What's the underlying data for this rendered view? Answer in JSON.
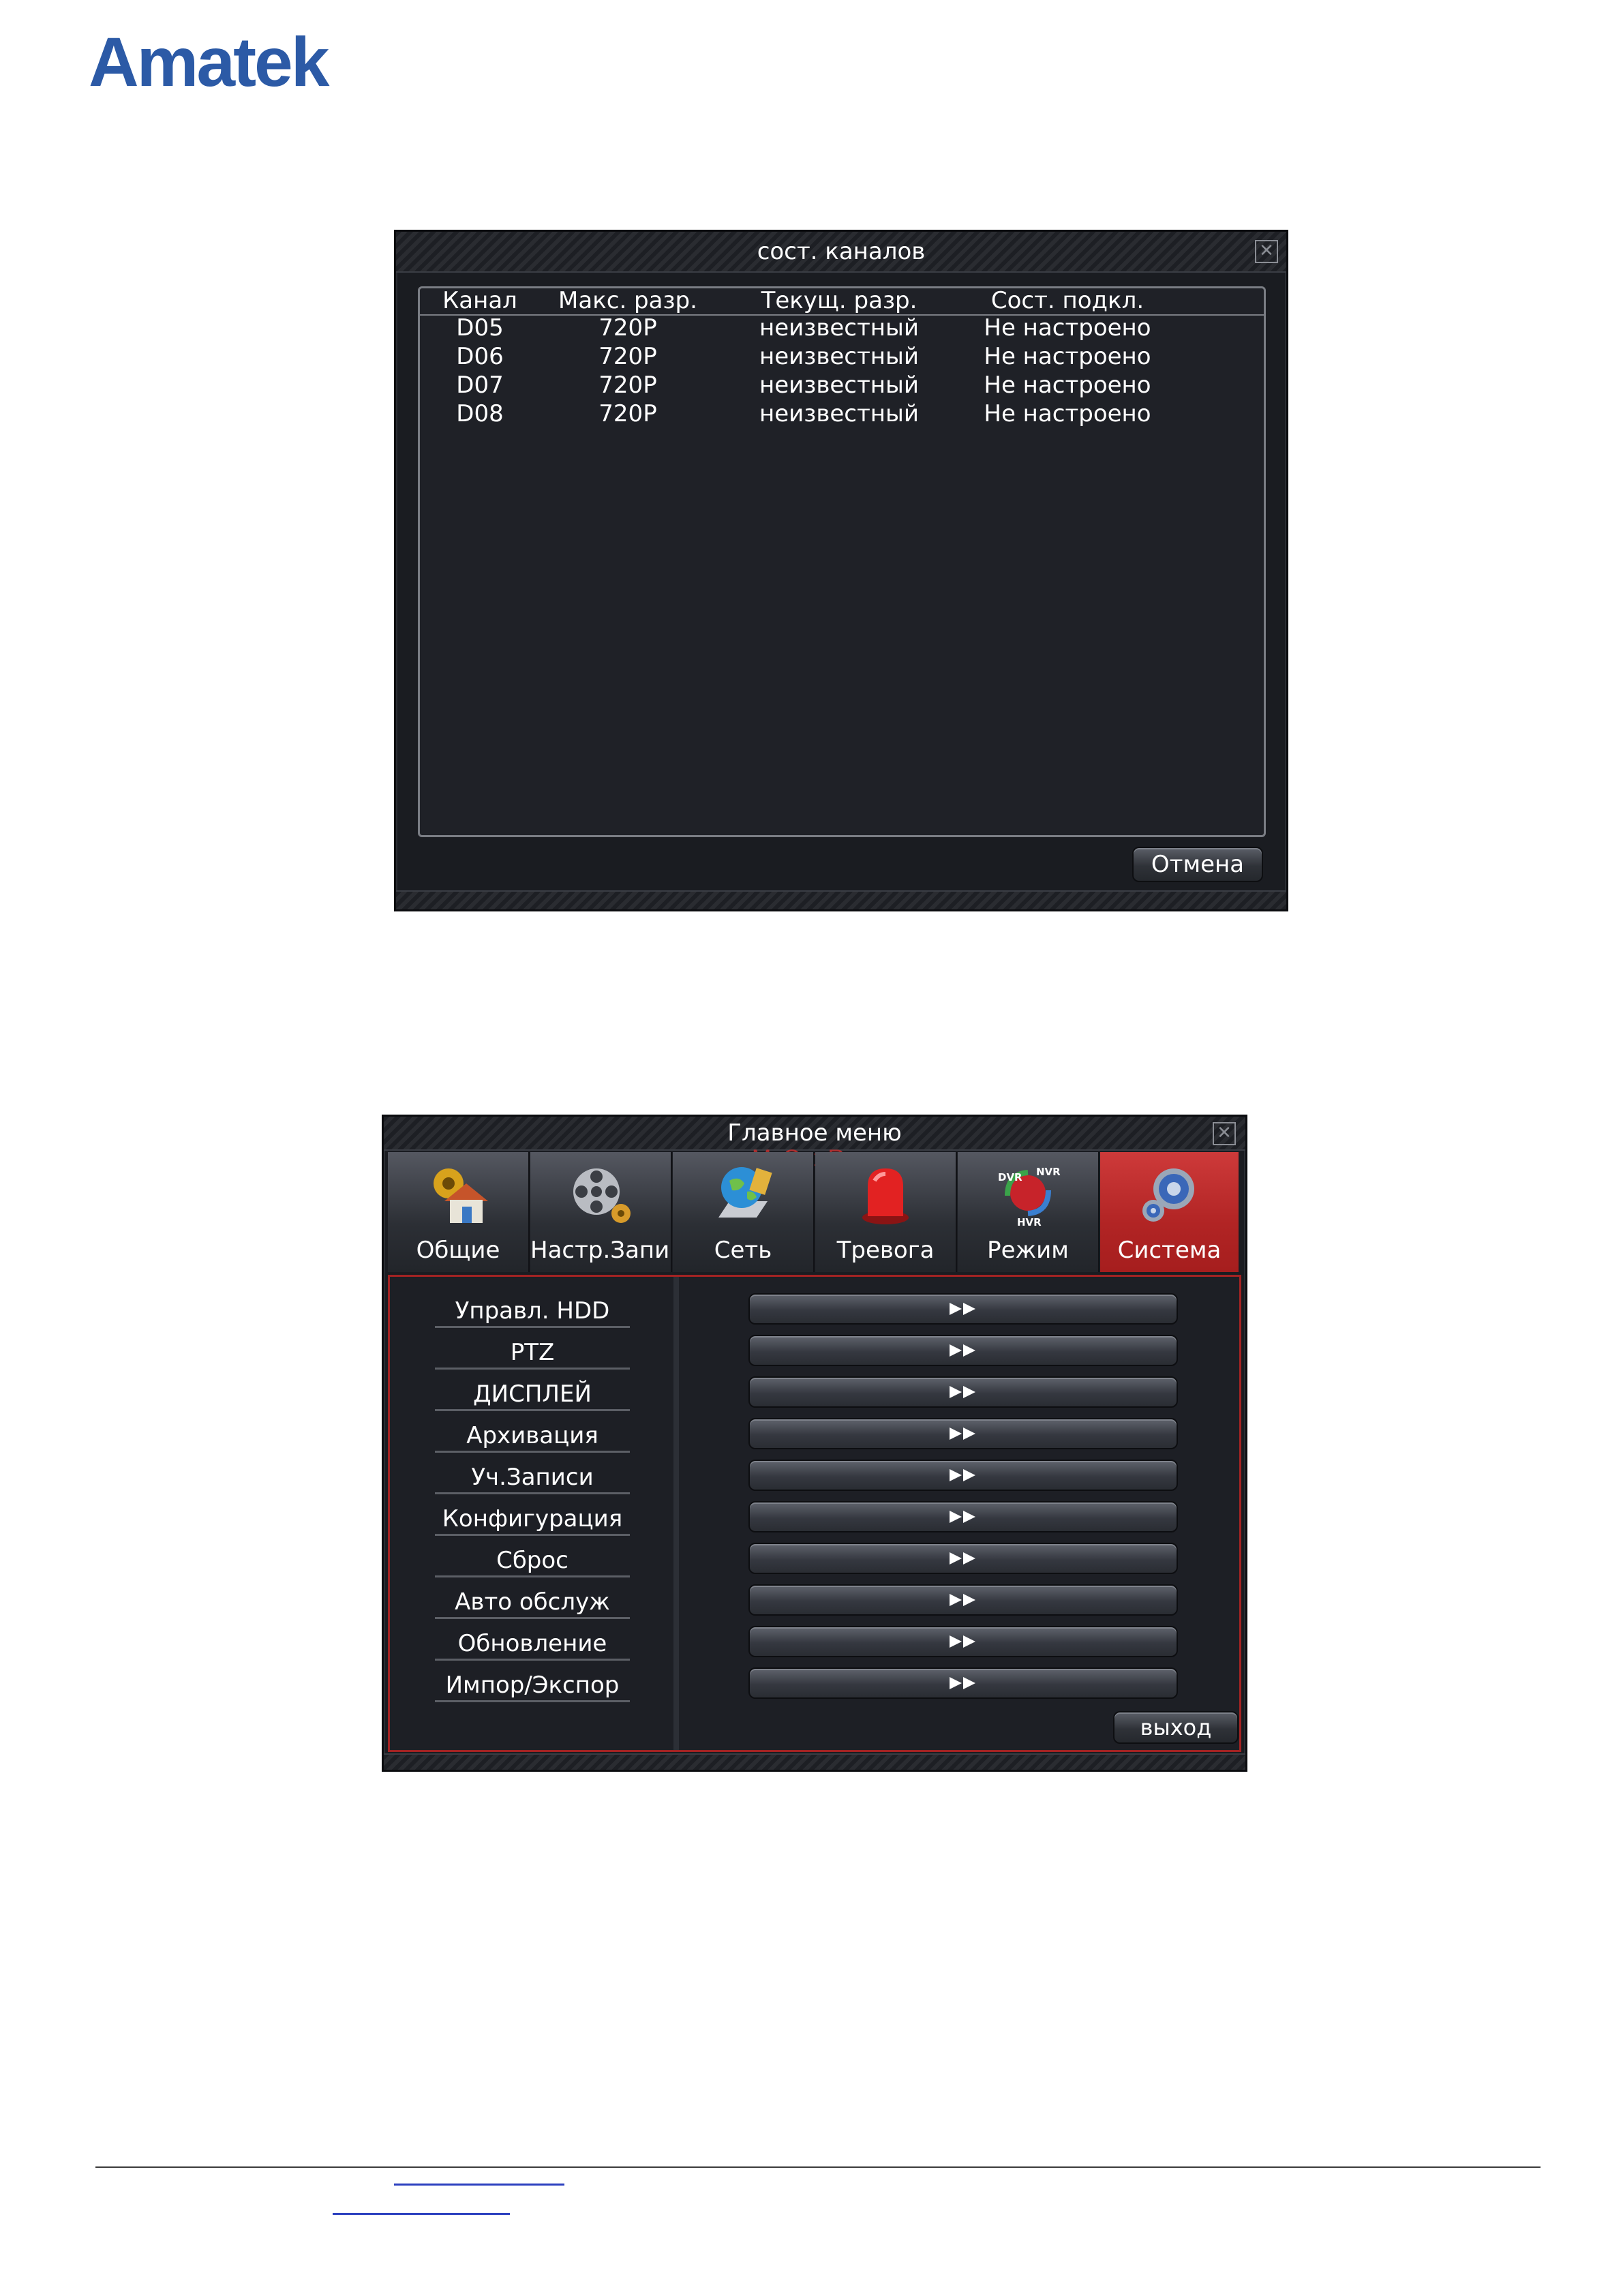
{
  "logo": {
    "text": "Amatek"
  },
  "channel_window": {
    "title": "сост. каналов",
    "close_icon": "close-x-icon",
    "columns": [
      "Канал",
      "Макс. разр.",
      "Текущ. разр.",
      "Сост. подкл."
    ],
    "rows": [
      [
        "D05",
        "720P",
        "неизвестный",
        "Не настроено"
      ],
      [
        "D06",
        "720P",
        "неизвестный",
        "Не настроено"
      ],
      [
        "D07",
        "720P",
        "неизвестный",
        "Не настроено"
      ],
      [
        "D08",
        "720P",
        "неизвестный",
        "Не настроено"
      ]
    ],
    "cancel_label": "Отмена"
  },
  "main_menu": {
    "title": "Главное меню",
    "watermark": "McGrp.Ru",
    "tabs": [
      {
        "label": "Общие",
        "icon": "house-gear-icon",
        "active": false
      },
      {
        "label": "Hастр.Запис",
        "icon": "film-reel-icon",
        "active": false
      },
      {
        "label": "Сеть",
        "icon": "globe-laptop-icon",
        "active": false
      },
      {
        "label": "Тревога",
        "icon": "alarm-siren-icon",
        "active": false
      },
      {
        "label": "Режим",
        "icon": "dvr-nvr-hvr-icon",
        "active": false
      },
      {
        "label": "Система",
        "icon": "gears-icon",
        "active": true
      }
    ],
    "items": [
      "Управл. HDD",
      "PTZ",
      "ДИСПЛЕЙ",
      "Архивация",
      "Уч.Записи",
      "Конфигурация",
      "Сброс",
      "Авто обслуж",
      "Обновление",
      "Импор/Экспор"
    ],
    "mode_icon_labels": {
      "dvr": "DVR",
      "nvr": "NVR",
      "hvr": "HVR"
    },
    "exit_label": "выход",
    "active_color": "#b52626"
  }
}
